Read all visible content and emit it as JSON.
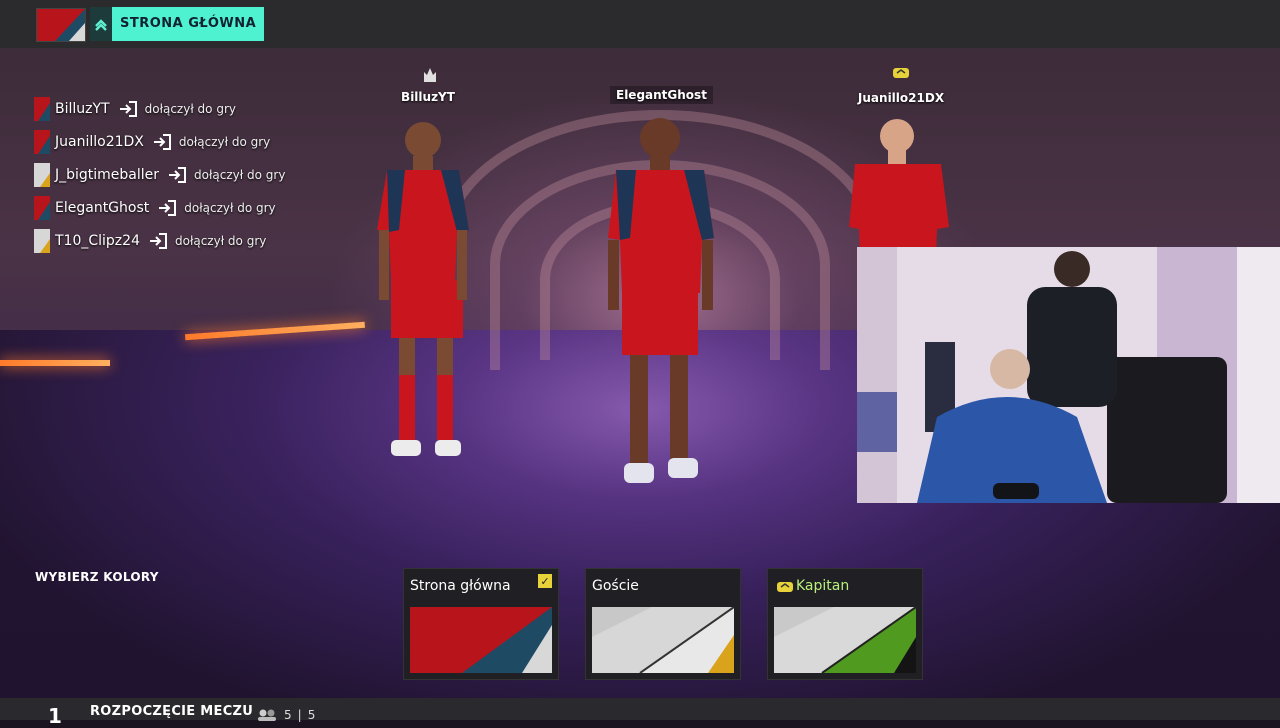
{
  "header": {
    "home_label": "STRONA GŁÓWNA",
    "home_icon": "chevron-up-icon"
  },
  "feed": [
    {
      "name": "BilluzYT",
      "action": "dołączył do gry",
      "flag": "red-navy"
    },
    {
      "name": "Juanillo21DX",
      "action": "dołączył do gry",
      "flag": "red-navy"
    },
    {
      "name": "J_bigtimeballer",
      "action": "dołączył do gry",
      "flag": "white-gold"
    },
    {
      "name": "ElegantGhost",
      "action": "dołączył do gry",
      "flag": "red-navy"
    },
    {
      "name": "T10_Clipz24",
      "action": "dołączył do gry",
      "flag": "white-gold"
    }
  ],
  "players": {
    "left": "BilluzYT",
    "center": "ElegantGhost",
    "right": "Juanillo21DX"
  },
  "kits": {
    "section_label": "WYBIERZ KOLORY",
    "options": [
      {
        "title": "Strona główna",
        "selected": true,
        "colors": [
          "#b8141c",
          "#1e4b63",
          "#d8d8d8"
        ]
      },
      {
        "title": "Goście",
        "selected": false,
        "colors": [
          "#d7d7d7",
          "#e8e8e8",
          "#d9a41c"
        ]
      },
      {
        "title": "Kapitan",
        "selected": false,
        "colors": [
          "#d9d9d9",
          "#4f9a1f",
          "#141414"
        ],
        "captain": true
      }
    ]
  },
  "footer": {
    "step_number": "1",
    "step_title": "ROZPOCZĘCIE MECZU",
    "count_left": "5",
    "count_right": "5"
  },
  "colors": {
    "accent": "#4ef2d0",
    "team_red": "#b8141c",
    "team_navy": "#1e4b63",
    "check_yellow": "#e8d23a"
  }
}
